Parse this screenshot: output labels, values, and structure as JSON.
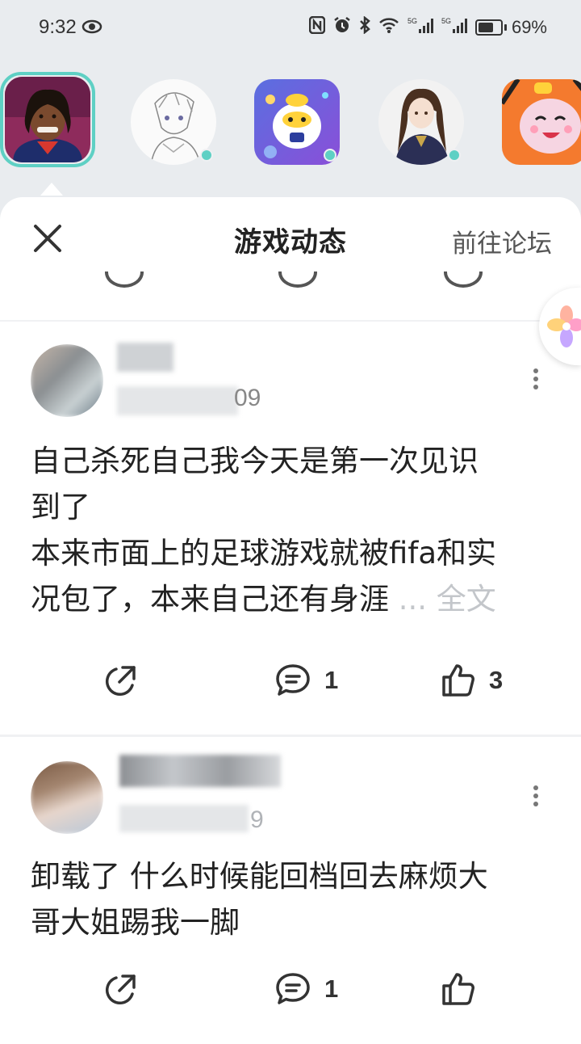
{
  "status_bar": {
    "time": "9:32",
    "battery_text": "69%",
    "battery_level": 0.69,
    "icons": [
      "eye-icon",
      "nfc-icon",
      "alarm-icon",
      "bluetooth-icon",
      "wifi-icon",
      "signal-5g-icon",
      "signal-5g-icon",
      "battery-icon"
    ]
  },
  "game_strip": {
    "items": [
      {
        "name": "football-game",
        "selected": true,
        "online": false
      },
      {
        "name": "anime-sketch-game",
        "selected": false,
        "online": true
      },
      {
        "name": "eggy-party-game",
        "selected": false,
        "online": true
      },
      {
        "name": "anime-girl-game",
        "selected": false,
        "online": true
      },
      {
        "name": "tiger-mascot-game",
        "selected": false,
        "online": false
      }
    ],
    "accent_color": "#5ed0c4"
  },
  "sheet": {
    "title": "游戏动态",
    "forum_link": "前往论坛"
  },
  "posts": [
    {
      "date_tail": "09",
      "text_lines": [
        "自己杀死自己我今天是第一次见识",
        "到了",
        "本来市面上的足球游戏就被fifa和实"
      ],
      "text_last": "况包了，本来自己还有身涯",
      "fulltext_label": "... 全文",
      "comments": "1",
      "likes": "3"
    },
    {
      "date_tail": "9",
      "text_lines": [
        "卸载了 什么时候能回档回去麻烦大",
        "哥大姐踢我一脚"
      ],
      "comments": "1",
      "likes": ""
    }
  ]
}
